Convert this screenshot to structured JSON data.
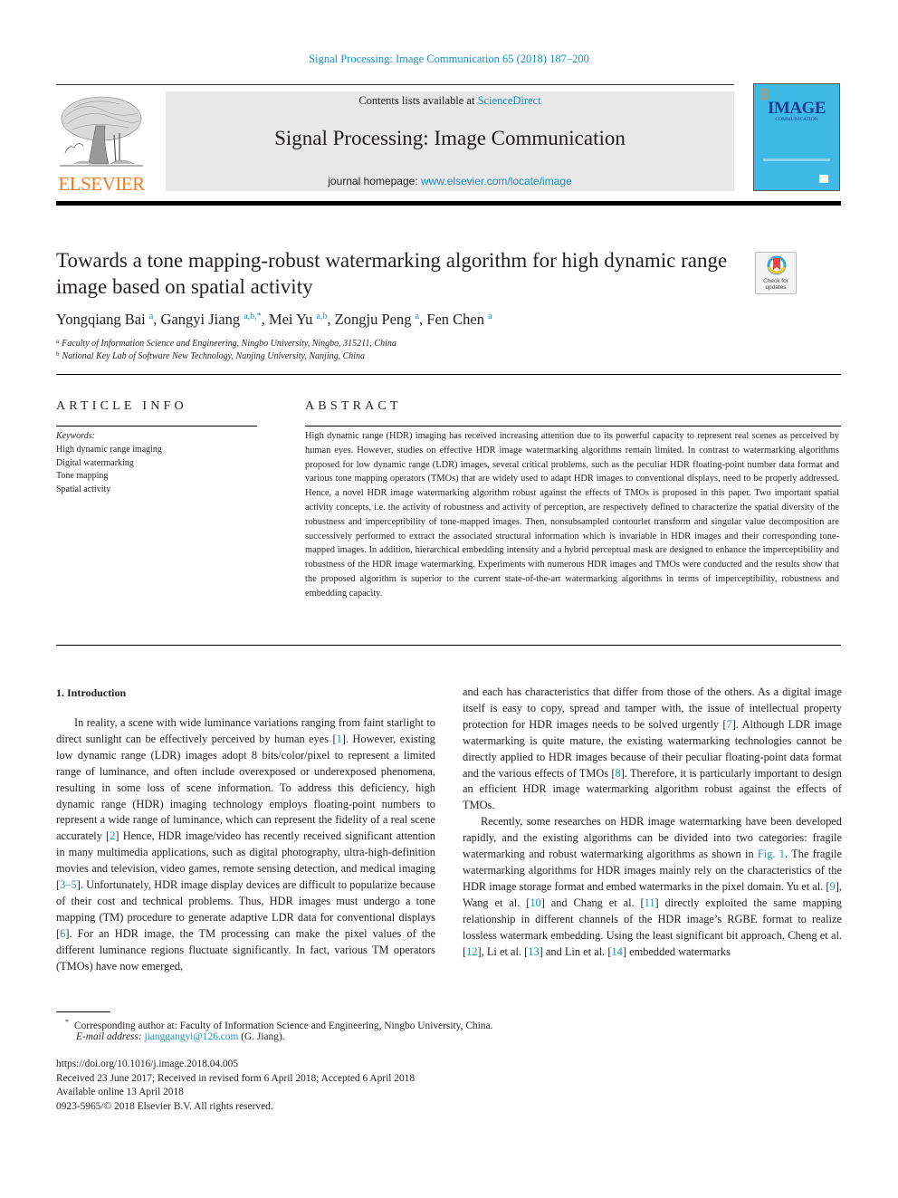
{
  "header": {
    "journal_ref": "Signal Processing: Image Communication 65 (2018) 187–200",
    "contents_prefix": "Contents lists available at ",
    "contents_link": "ScienceDirect",
    "journal_title": "Signal Processing: Image Communication",
    "homepage_prefix": "journal homepage: ",
    "homepage_link": "www.elsevier.com/locate/image",
    "publisher_logo": "ELSEVIER",
    "cover_title": "IMAGE",
    "cover_subtitle": "COMMUNICATION"
  },
  "article": {
    "title": "Towards a tone mapping-robust watermarking algorithm for high dynamic range image based on spatial activity",
    "check_updates": "Check for updates",
    "authors": [
      {
        "name": "Yongqiang Bai",
        "sup": "a"
      },
      {
        "name": "Gangyi Jiang",
        "sup": "a,b,*"
      },
      {
        "name": "Mei Yu",
        "sup": "a,b"
      },
      {
        "name": "Zongju Peng",
        "sup": "a"
      },
      {
        "name": "Fen Chen",
        "sup": "a"
      }
    ],
    "affiliations": [
      {
        "mark": "a",
        "text": "Faculty of Information Science and Engineering, Ningbo University, Ningbo, 315211, China"
      },
      {
        "mark": "b",
        "text": "National Key Lab of Software New Technology, Nanjing University, Nanjing, China"
      }
    ]
  },
  "article_info": {
    "heading": "ARTICLE INFO",
    "keywords_label": "Keywords:",
    "keywords": [
      "High dynamic range imaging",
      "Digital watermarking",
      "Tone mapping",
      "Spatial activity"
    ]
  },
  "abstract": {
    "heading": "ABSTRACT",
    "text": "High dynamic range (HDR) imaging has received increasing attention due to its powerful capacity to represent real scenes as perceived by human eyes. However, studies on effective HDR image watermarking algorithms remain limited. In contrast to watermarking algorithms proposed for low dynamic range (LDR) images, several critical problems, such as the peculiar HDR floating-point number data format and various tone mapping operators (TMOs) that are widely used to adapt HDR images to conventional displays, need to be properly addressed. Hence, a novel HDR image watermarking algorithm robust against the effects of TMOs is proposed in this paper. Two important spatial activity concepts, i.e. the activity of robustness and activity of perception, are respectively defined to characterize the spatial diversity of the robustness and imperceptibility of tone-mapped images. Then, nonsubsampled contourlet transform and singular value decomposition are successively performed to extract the associated structural information which is invariable in HDR images and their corresponding tone-mapped images. In addition, hierarchical embedding intensity and a hybrid perceptual mask are designed to enhance the imperceptibility and robustness of the HDR image watermarking. Experiments with numerous HDR images and TMOs were conducted and the results show that the proposed algorithm is superior to the current state-of-the-art watermarking algorithms in terms of imperceptibility, robustness and embedding capacity."
  },
  "intro": {
    "heading": "1. Introduction",
    "left_p1": [
      {
        "t": "In reality, a scene with wide luminance variations ranging from faint starlight to direct sunlight can be effectively perceived by human eyes ["
      },
      {
        "t": "1",
        "ref": true
      },
      {
        "t": "]. However, existing low dynamic range (LDR) images adopt 8 bits/color/pixel to represent a limited range of luminance, and often include overexposed or underexposed phenomena, resulting in some loss of scene information. To address this deficiency, high dynamic range (HDR) imaging technology employs floating-point numbers to represent a wide range of luminance, which can represent the fidelity of a real scene accurately ["
      },
      {
        "t": "2",
        "ref": true
      },
      {
        "t": "] Hence, HDR image/video has recently received significant attention in many multimedia applications, such as digital photography, ultra-high-definition movies and television, video games, remote sensing detection, and medical imaging ["
      },
      {
        "t": "3–5",
        "ref": true
      },
      {
        "t": "]. Unfortunately, HDR image display devices are difficult to popularize because of their cost and technical problems. Thus, HDR images must undergo a tone mapping (TM) procedure to generate adaptive LDR data for conventional displays ["
      },
      {
        "t": "6",
        "ref": true
      },
      {
        "t": "]. For an HDR image, the TM processing can make the pixel values of the different luminance regions fluctuate significantly. In fact, various TM operators (TMOs) have now emerged,"
      }
    ],
    "right_p1": [
      {
        "t": "and each has characteristics that differ from those of the others. As a digital image itself is easy to copy, spread and tamper with, the issue of intellectual property protection for HDR images needs to be solved urgently ["
      },
      {
        "t": "7",
        "ref": true
      },
      {
        "t": "]. Although LDR image watermarking is quite mature, the existing watermarking technologies cannot be directly applied to HDR images because of their peculiar floating-point data format and the various effects of TMOs ["
      },
      {
        "t": "8",
        "ref": true
      },
      {
        "t": "]. Therefore, it is particularly important to design an efficient HDR image watermarking algorithm robust against the effects of TMOs."
      }
    ],
    "right_p2": [
      {
        "t": "Recently, some researches on HDR image watermarking have been developed rapidly, and the existing algorithms can be divided into two categories: fragile watermarking and robust watermarking algorithms as shown in "
      },
      {
        "t": "Fig. 1",
        "ref": true
      },
      {
        "t": ". The fragile watermarking algorithms for HDR images mainly rely on the characteristics of the HDR image storage format and embed watermarks in the pixel domain. Yu et al. ["
      },
      {
        "t": "9",
        "ref": true
      },
      {
        "t": "], Wang et al. ["
      },
      {
        "t": "10",
        "ref": true
      },
      {
        "t": "] and Chang et al. ["
      },
      {
        "t": "11",
        "ref": true
      },
      {
        "t": "] directly exploited the same mapping relationship in different channels of the HDR image’s RGBE format to realize lossless watermark embedding. Using the least significant bit approach, Cheng et al. ["
      },
      {
        "t": "12",
        "ref": true
      },
      {
        "t": "], Li et al. ["
      },
      {
        "t": "13",
        "ref": true
      },
      {
        "t": "] and Lin et al. ["
      },
      {
        "t": "14",
        "ref": true
      },
      {
        "t": "] embedded watermarks"
      }
    ]
  },
  "footnotes": {
    "corresponding_mark": "*",
    "corresponding": "Corresponding author at: Faculty of Information Science and Engineering, Ningbo University, China.",
    "email_label": "E-mail address:",
    "email": "jianggangyi@126.com",
    "email_suffix": " (G. Jiang).",
    "doi": "https://doi.org/10.1016/j.image.2018.04.005",
    "received": "Received 23 June 2017; Received in revised form 6 April 2018; Accepted 6 April 2018",
    "available": "Available online 13 April 2018",
    "copyright": "0923-5965/© 2018 Elsevier B.V. All rights reserved."
  }
}
